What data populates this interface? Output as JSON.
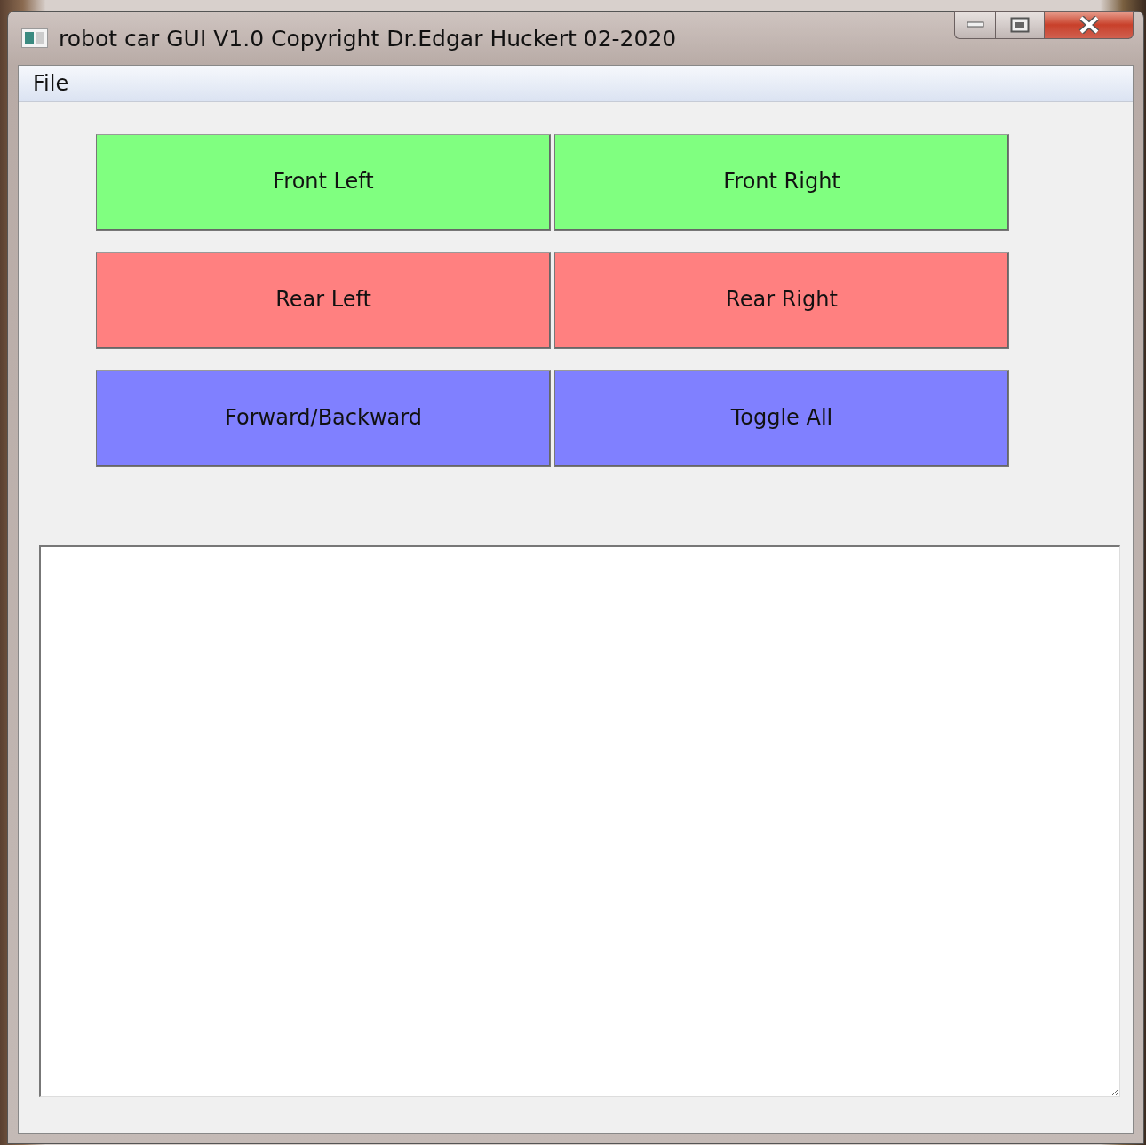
{
  "window": {
    "title": "robot car GUI V1.0 Copyright Dr.Edgar Huckert 02-2020"
  },
  "menu": [
    "File"
  ],
  "buttons": [
    {
      "label": "Front Left",
      "color": "#80ff80"
    },
    {
      "label": "Front Right",
      "color": "#80ff80"
    },
    {
      "label": "Rear Left",
      "color": "#ff8080"
    },
    {
      "label": "Rear Right",
      "color": "#ff8080"
    },
    {
      "label": "Forward/Backward",
      "color": "#8080ff"
    },
    {
      "label": "Toggle All",
      "color": "#8080ff"
    }
  ]
}
